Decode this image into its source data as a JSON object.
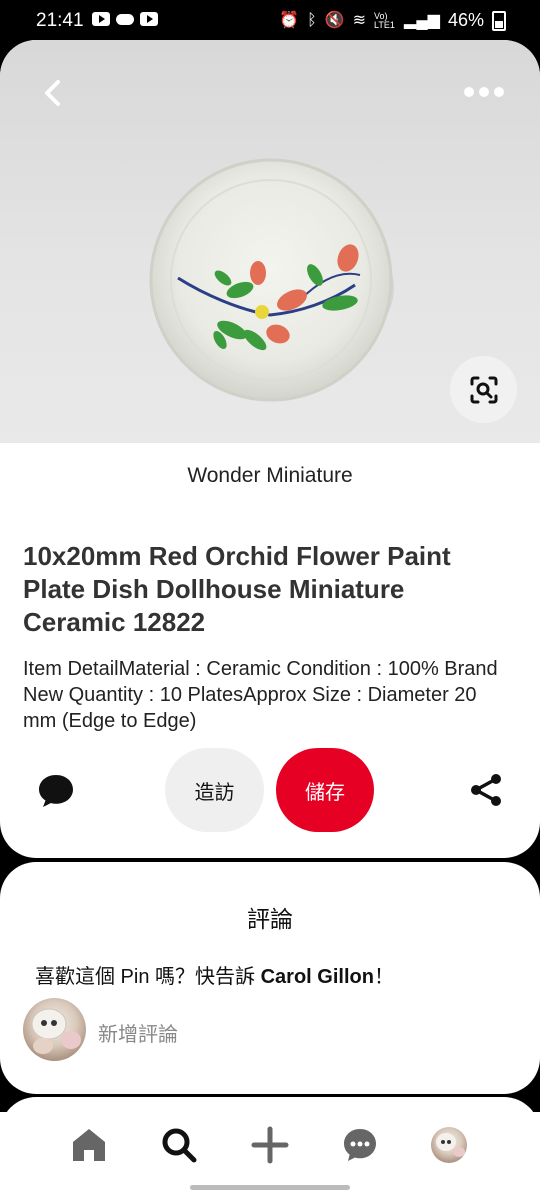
{
  "status_bar": {
    "time": "21:41",
    "left_icons": [
      "youtube-icon",
      "cloud-icon",
      "youtube-icon"
    ],
    "right_icons": [
      "alarm-icon",
      "bluetooth-icon",
      "mute-icon",
      "wifi-icon",
      "volte-icon",
      "signal-icon"
    ],
    "network_label": "Vo) LTE1",
    "battery": "46%"
  },
  "pin": {
    "source": "Wonder Miniature",
    "title": "10x20mm Red Orchid Flower Paint Plate Dish Dollhouse Miniature Ceramic 12822",
    "description": "Item DetailMaterial : Ceramic Condition : 100% Brand New Quantity : 10 PlatesApprox Size : Diameter 20 mm (Edge to Edge)",
    "visit_label": "造訪",
    "save_label": "儲存",
    "save_color": "#e60023"
  },
  "comments": {
    "title": "評論",
    "prompt_prefix": "喜歡這個 Pin 嗎？快告訴",
    "author": "Carol Gillon",
    "prompt_suffix": "！",
    "add_placeholder": "新增評論"
  },
  "nav": {
    "items": [
      "home-icon",
      "search-icon",
      "plus-icon",
      "messages-icon",
      "profile-avatar"
    ],
    "active": "search-icon"
  }
}
